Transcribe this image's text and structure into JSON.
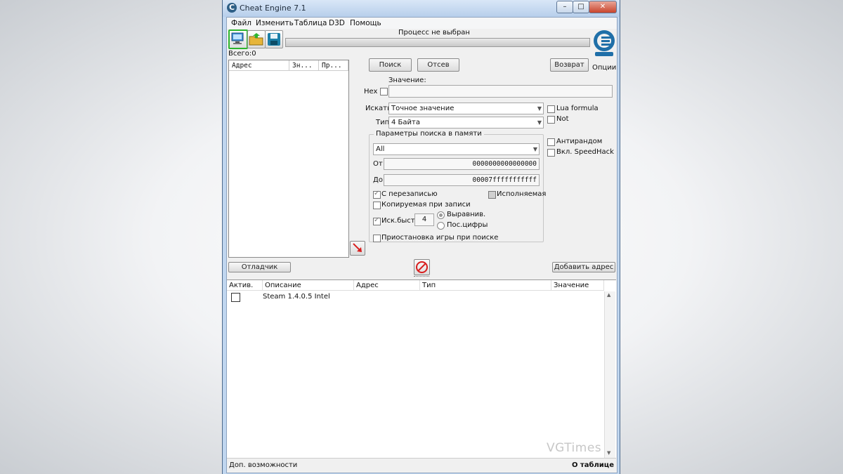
{
  "window": {
    "title": "Cheat Engine 7.1",
    "caption_buttons": [
      "minimize",
      "maximize",
      "close"
    ]
  },
  "menu": [
    "Файл",
    "Изменить",
    "Таблица",
    "D3D",
    "Помощь"
  ],
  "toolbar": {
    "icons": [
      "open-process-icon",
      "open-file-icon",
      "save-icon"
    ]
  },
  "process_label": "Процесс не выбран",
  "logo_icon": "cheat-engine-logo",
  "options_label": "Опции",
  "scan_results": {
    "total_label": "Всего:0",
    "columns": [
      "Адрес",
      "Зн...",
      "Пр..."
    ]
  },
  "buttons": {
    "search": "Поиск",
    "filter": "Отсев",
    "undo": "Возврат",
    "debugger": "Отладчик",
    "add_address": "Добавить адрес"
  },
  "value": {
    "label": "Значение:",
    "hex_label": "Hex",
    "hex_checked": false,
    "value": ""
  },
  "scan_type": {
    "label": "Искать",
    "selected": "Точное значение"
  },
  "value_type": {
    "label": "Тип",
    "selected": "4 Байта"
  },
  "side_options": {
    "lua_formula": "Lua formula",
    "not": "Not",
    "antirandom": "Антирандом",
    "speedhack": "Вкл. SpeedHack"
  },
  "memory": {
    "title": "Параметры поиска в памяти",
    "region": "All",
    "from_label": "От",
    "from_value": "0000000000000000",
    "to_label": "До",
    "to_value": "00007fffffffffff",
    "writable": "С перезаписью",
    "writable_checked": true,
    "executable": "Исполняемая",
    "executable_state": "indeterminate",
    "copy_on_write": "Копируемая при записи",
    "copy_on_write_checked": false,
    "fast_scan": "Иск.быст.",
    "fast_scan_checked": true,
    "fast_scan_value": "4",
    "alignment": "Выравнив.",
    "last_digits": "Пос.цифры",
    "alignment_selected": true,
    "pause_game": "Приостановка игры при поиске",
    "pause_checked": false
  },
  "cheat_table": {
    "columns": [
      "Актив.",
      "Описание",
      "Адрес",
      "Тип",
      "Значение"
    ],
    "rows": [
      {
        "active": false,
        "description": "Steam 1.4.0.5 Intel",
        "address": "",
        "type": "",
        "value": ""
      }
    ]
  },
  "statusbar": {
    "left": "Доп. возможности",
    "right": "О таблице"
  },
  "watermark": "VGTimes",
  "colors": {
    "accent_green": "#2db52d",
    "title_gradient": "#c0d6ef",
    "logo_blue": "#1f6fa8",
    "arrow_red": "#d81e1e"
  }
}
